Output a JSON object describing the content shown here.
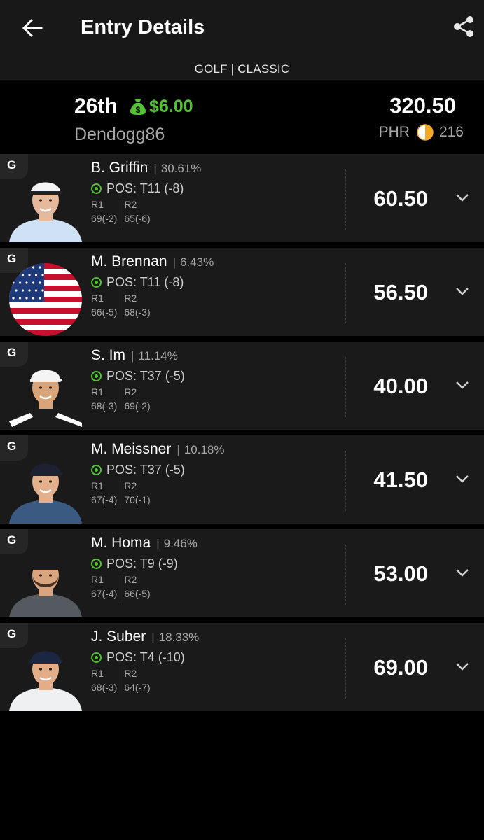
{
  "header": {
    "title": "Entry Details"
  },
  "contest": {
    "label": "GOLF | CLASSIC"
  },
  "entry": {
    "rank": "26th",
    "prize": "$6.00",
    "username": "Dendogg86",
    "total_points": "320.50",
    "phr_label": "PHR",
    "phr_value": "216",
    "phr_progress": 0.5
  },
  "colors": {
    "accent_green": "#52c234",
    "phr_orange": "#f5a623"
  },
  "players": [
    {
      "badge": "G",
      "name": "B. Griffin",
      "ownership": "30.61%",
      "pos": "POS: T11 (-8)",
      "r1_label": "R1",
      "r1": "69(-2)",
      "r2_label": "R2",
      "r2": "65(-6)",
      "points": "60.50"
    },
    {
      "badge": "G",
      "name": "M. Brennan",
      "ownership": "6.43%",
      "pos": "POS: T11 (-8)",
      "r1_label": "R1",
      "r1": "66(-5)",
      "r2_label": "R2",
      "r2": "68(-3)",
      "points": "56.50"
    },
    {
      "badge": "G",
      "name": "S. Im",
      "ownership": "11.14%",
      "pos": "POS: T37 (-5)",
      "r1_label": "R1",
      "r1": "68(-3)",
      "r2_label": "R2",
      "r2": "69(-2)",
      "points": "40.00"
    },
    {
      "badge": "G",
      "name": "M. Meissner",
      "ownership": "10.18%",
      "pos": "POS: T37 (-5)",
      "r1_label": "R1",
      "r1": "67(-4)",
      "r2_label": "R2",
      "r2": "70(-1)",
      "points": "41.50"
    },
    {
      "badge": "G",
      "name": "M. Homa",
      "ownership": "9.46%",
      "pos": "POS: T9 (-9)",
      "r1_label": "R1",
      "r1": "67(-4)",
      "r2_label": "R2",
      "r2": "66(-5)",
      "points": "53.00"
    },
    {
      "badge": "G",
      "name": "J. Suber",
      "ownership": "18.33%",
      "pos": "POS: T4 (-10)",
      "r1_label": "R1",
      "r1": "68(-3)",
      "r2_label": "R2",
      "r2": "64(-7)",
      "points": "69.00"
    }
  ]
}
